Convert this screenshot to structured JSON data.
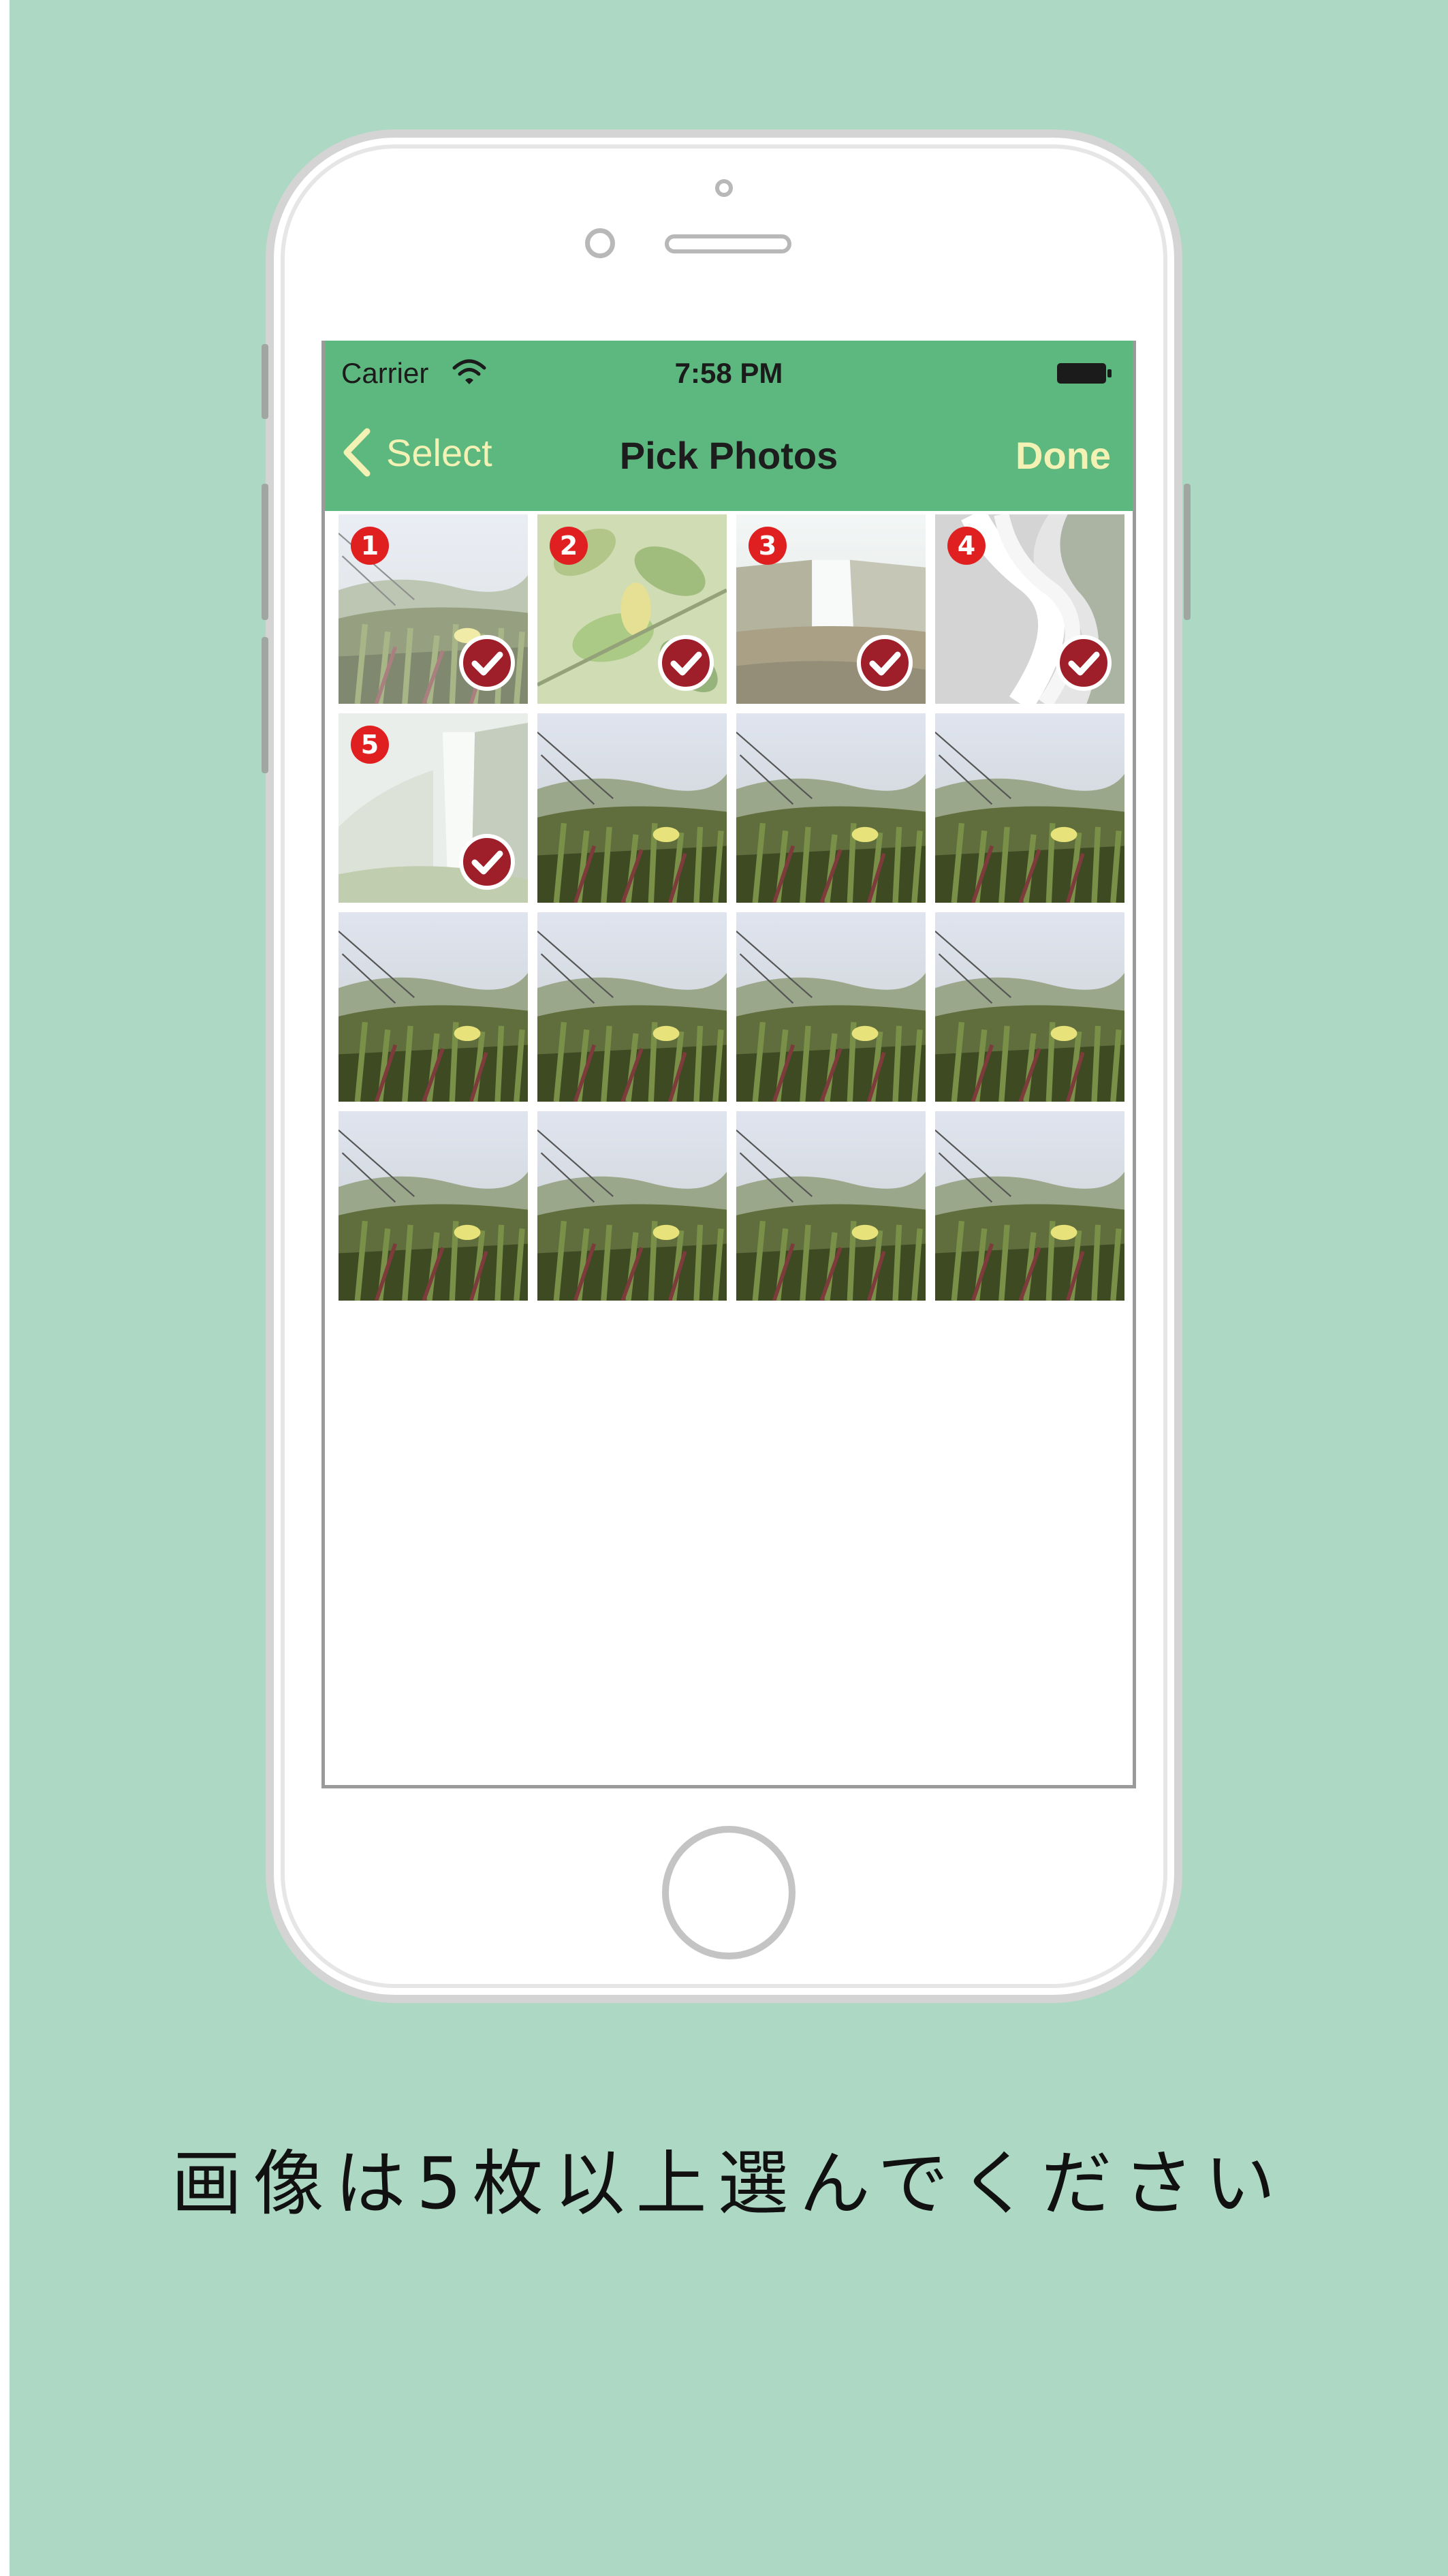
{
  "status_bar": {
    "carrier": "Carrier",
    "time": "7:58 PM"
  },
  "nav_bar": {
    "back_label": "Select",
    "title": "Pick Photos",
    "done_label": "Done"
  },
  "photos": [
    {
      "kind": "meadow",
      "selected": true,
      "order": "1"
    },
    {
      "kind": "leaves",
      "selected": true,
      "order": "2"
    },
    {
      "kind": "falls",
      "selected": true,
      "order": "3"
    },
    {
      "kind": "stream",
      "selected": true,
      "order": "4"
    },
    {
      "kind": "mist",
      "selected": true,
      "order": "5"
    },
    {
      "kind": "meadow",
      "selected": false
    },
    {
      "kind": "meadow",
      "selected": false
    },
    {
      "kind": "meadow",
      "selected": false
    },
    {
      "kind": "meadow",
      "selected": false
    },
    {
      "kind": "meadow",
      "selected": false
    },
    {
      "kind": "meadow",
      "selected": false
    },
    {
      "kind": "meadow",
      "selected": false
    },
    {
      "kind": "meadow",
      "selected": false
    },
    {
      "kind": "meadow",
      "selected": false
    },
    {
      "kind": "meadow",
      "selected": false
    },
    {
      "kind": "meadow",
      "selected": false
    }
  ],
  "caption": "画像は5枚以上選んでください",
  "colors": {
    "background": "#acd8c4",
    "nav_bar": "#5cb87e",
    "nav_accent": "#f4f1b4",
    "badge": "#e02020",
    "check": "#9e1e2a"
  },
  "icons": [
    "wifi-icon",
    "battery-icon",
    "chevron-left-icon",
    "checkmark-icon"
  ]
}
